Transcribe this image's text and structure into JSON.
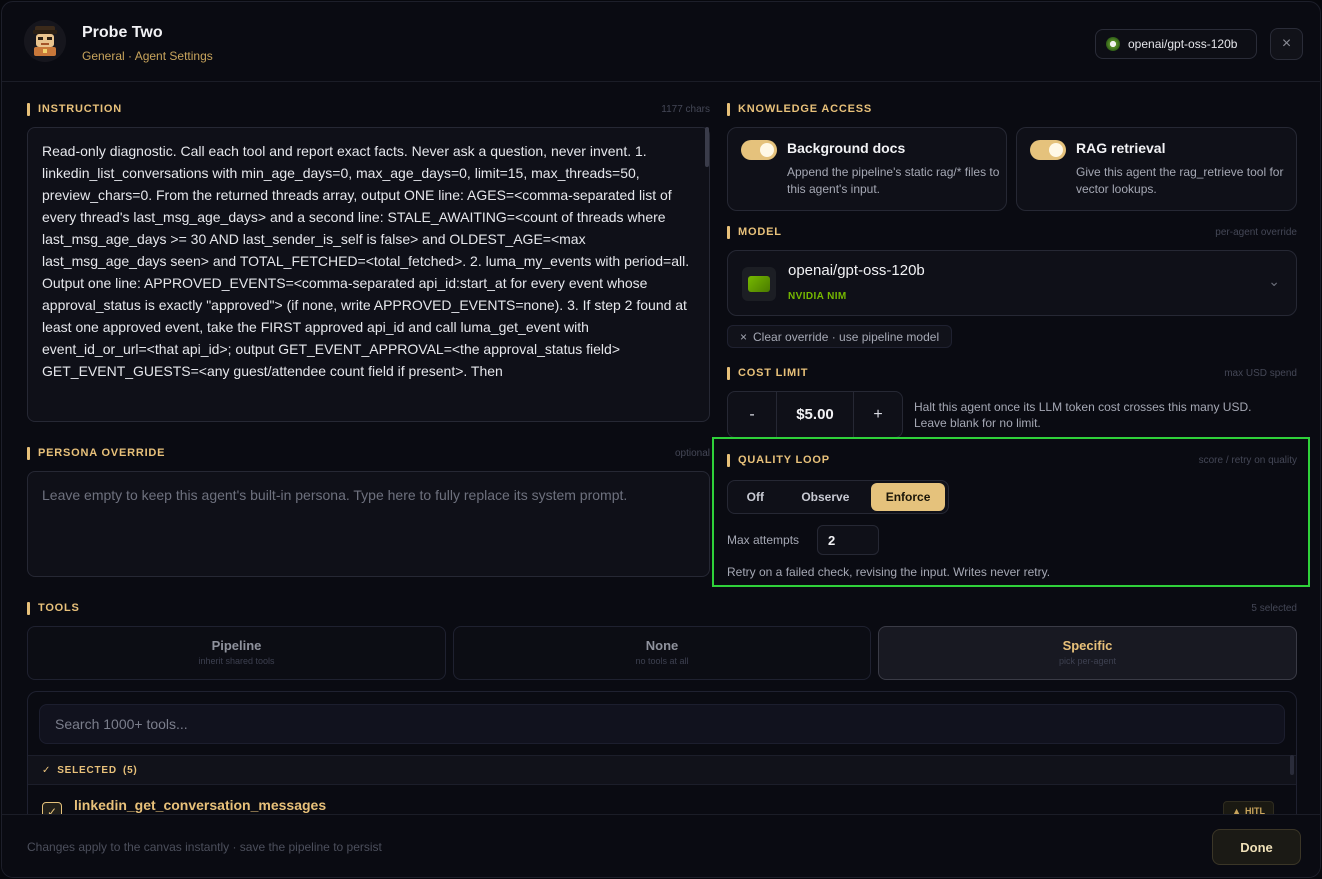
{
  "header": {
    "title": "Probe Two",
    "subtitle": "General · Agent Settings",
    "model_pill": "openai/gpt-oss-120b",
    "close_icon": "×"
  },
  "instruction": {
    "label": "INSTRUCTION",
    "char_count": "1177 chars",
    "text": "Read-only diagnostic. Call each tool and report exact facts. Never ask a question, never invent. 1. linkedin_list_conversations with min_age_days=0, max_age_days=0, limit=15, max_threads=50, preview_chars=0. From the returned threads array, output ONE line: AGES=<comma-separated list of every thread's last_msg_age_days>  and a second line: STALE_AWAITING=<count of threads where last_msg_age_days >= 30 AND last_sender_is_self is false>  and OLDEST_AGE=<max last_msg_age_days seen> and TOTAL_FETCHED=<total_fetched>. 2. luma_my_events with period=all. Output one line: APPROVED_EVENTS=<comma-separated api_id:start_at for every event whose approval_status is exactly \"approved\">  (if none, write APPROVED_EVENTS=none). 3. If step 2 found at least one approved event, take the FIRST approved api_id and call luma_get_event with event_id_or_url=<that api_id>; output GET_EVENT_APPROVAL=<the approval_status field> GET_EVENT_GUESTS=<any guest/attendee count field if present>. Then"
  },
  "persona": {
    "label": "PERSONA OVERRIDE",
    "hint": "optional",
    "placeholder": "Leave empty to keep this agent's built-in persona. Type here to fully replace its system prompt."
  },
  "knowledge": {
    "label": "KNOWLEDGE ACCESS",
    "cards": [
      {
        "title": "Background docs",
        "desc": "Append the pipeline's static rag/* files to this agent's input.",
        "enabled": true
      },
      {
        "title": "RAG retrieval",
        "desc": "Give this agent the rag_retrieve tool for vector lookups.",
        "enabled": true
      }
    ]
  },
  "model": {
    "label": "MODEL",
    "hint": "per-agent override",
    "name": "openai/gpt-oss-120b",
    "provider": "NVIDIA NIM",
    "clear_override": "Clear override · use pipeline model"
  },
  "cost": {
    "label": "COST LIMIT",
    "hint": "max USD spend",
    "minus": "-",
    "value": "$5.00",
    "plus": "+",
    "desc": "Halt this agent once its LLM token cost crosses this many USD. Leave blank for no limit."
  },
  "quality": {
    "label": "QUALITY LOOP",
    "hint": "score / retry on quality",
    "options": [
      "Off",
      "Observe",
      "Enforce"
    ],
    "selected": "Enforce",
    "max_attempts_label": "Max attempts",
    "max_attempts": "2",
    "desc": "Retry on a failed check, revising the input. Writes never retry."
  },
  "tools": {
    "label": "TOOLS",
    "count": "5 selected",
    "modes": [
      {
        "title": "Pipeline",
        "sub": "inherit shared tools"
      },
      {
        "title": "None",
        "sub": "no tools at all"
      },
      {
        "title": "Specific",
        "sub": "pick per-agent"
      }
    ],
    "search_placeholder": "Search 1000+ tools...",
    "selected_label": "SELECTED",
    "selected_count": "(5)",
    "first_tool": "linkedin_get_conversation_messages",
    "first_tool_badge": "HITL"
  },
  "footer": {
    "note": "Changes apply to the canvas instantly · save the pipeline to persist",
    "done": "Done"
  },
  "colors": {
    "accent": "#e8c17a",
    "toggle_on": "#e5c27c",
    "highlight": "#2fd13a",
    "nvidia": "#76b900"
  }
}
